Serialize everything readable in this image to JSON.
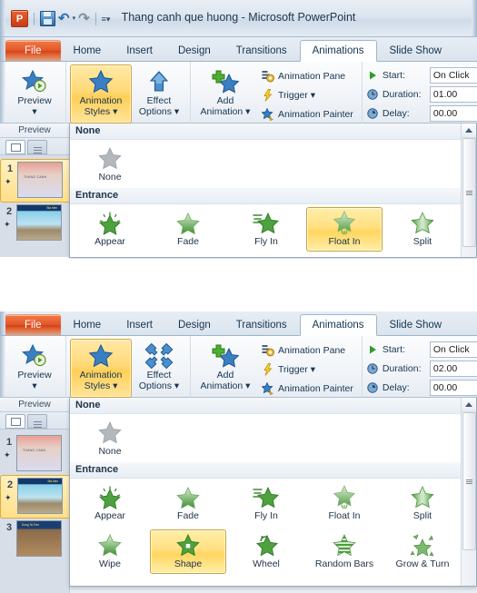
{
  "app": {
    "title": "Thang canh que huong  -  Microsoft PowerPoint",
    "logo_text": "P",
    "quick_access": [
      {
        "name": "save-icon",
        "label": "Save"
      },
      {
        "name": "undo-icon",
        "label": "↶"
      },
      {
        "name": "undo-dropdown-icon",
        "label": "▾"
      },
      {
        "name": "redo-icon",
        "label": "↷"
      },
      {
        "name": "customize-qat-icon",
        "label": "≡▾"
      }
    ]
  },
  "tabs": [
    {
      "label": "File",
      "state": "file"
    },
    {
      "label": "Home",
      "state": "normal"
    },
    {
      "label": "Insert",
      "state": "normal"
    },
    {
      "label": "Design",
      "state": "normal"
    },
    {
      "label": "Transitions",
      "state": "normal"
    },
    {
      "label": "Animations",
      "state": "active"
    },
    {
      "label": "Slide Show",
      "state": "normal"
    }
  ],
  "ribbon": {
    "preview": {
      "label_line1": "Preview",
      "dropdown": "▾",
      "group_label": "Preview"
    },
    "animation_styles": {
      "label_line1": "Animation",
      "label_line2": "Styles ▾"
    },
    "effect_options": {
      "label_line1": "Effect",
      "label_line2": "Options ▾"
    },
    "add_animation": {
      "label_line1": "Add",
      "label_line2": "Animation ▾"
    },
    "advanced": [
      {
        "label": "Animation Pane",
        "icon": "animation-pane-icon"
      },
      {
        "label": "Trigger ▾",
        "icon": "trigger-lightning-icon"
      },
      {
        "label": "Animation Painter",
        "icon": "animation-painter-icon"
      }
    ],
    "timing_panel1": {
      "start": {
        "label": "Start:",
        "value": "On Click",
        "icon": "play-triangle-icon"
      },
      "duration": {
        "label": "Duration:",
        "value": "01.00",
        "icon": "clock-icon"
      },
      "delay": {
        "label": "Delay:",
        "value": "00.00",
        "icon": "clock-icon"
      }
    },
    "timing_panel2": {
      "start": {
        "label": "Start:",
        "value": "On Click",
        "icon": "play-triangle-icon"
      },
      "duration": {
        "label": "Duration:",
        "value": "02.00",
        "icon": "clock-icon"
      },
      "delay": {
        "label": "Delay:",
        "value": "00.00",
        "icon": "clock-icon"
      }
    }
  },
  "slide_pane": {
    "preview_label": "Preview",
    "panel1": {
      "slides": [
        {
          "number": "1",
          "selected": true,
          "theme": "sl1",
          "caption": "THANG CANH"
        },
        {
          "number": "2",
          "selected": false,
          "theme": "sl2",
          "caption": "Bia bien"
        }
      ]
    },
    "panel2": {
      "slides": [
        {
          "number": "1",
          "selected": false,
          "theme": "sl1",
          "caption": "THANG CANH"
        },
        {
          "number": "2",
          "selected": true,
          "theme": "sl2",
          "caption": "Bia bien"
        },
        {
          "number": "3",
          "selected": false,
          "theme": "sl3",
          "caption": "Dong Ta Tren"
        }
      ]
    }
  },
  "gallery": {
    "headings": {
      "none": "None",
      "entrance": "Entrance"
    },
    "none_item": {
      "label": "None"
    },
    "panel1": {
      "entrance_rows": [
        [
          {
            "label": "Appear",
            "selected": false,
            "star": "sparkle"
          },
          {
            "label": "Fade",
            "selected": false,
            "star": "plain"
          },
          {
            "label": "Fly In",
            "selected": false,
            "star": "speed"
          },
          {
            "label": "Float In",
            "selected": true,
            "star": "float"
          },
          {
            "label": "Split",
            "selected": false,
            "star": "split"
          }
        ]
      ]
    },
    "panel2": {
      "entrance_rows": [
        [
          {
            "label": "Appear",
            "selected": false,
            "star": "sparkle"
          },
          {
            "label": "Fade",
            "selected": false,
            "star": "plain"
          },
          {
            "label": "Fly In",
            "selected": false,
            "star": "speed"
          },
          {
            "label": "Float In",
            "selected": false,
            "star": "float"
          },
          {
            "label": "Split",
            "selected": false,
            "star": "split"
          }
        ],
        [
          {
            "label": "Wipe",
            "selected": false,
            "star": "wipe"
          },
          {
            "label": "Shape",
            "selected": true,
            "star": "shape"
          },
          {
            "label": "Wheel",
            "selected": false,
            "star": "wheel"
          },
          {
            "label": "Random Bars",
            "selected": false,
            "star": "bars"
          },
          {
            "label": "Grow & Turn",
            "selected": false,
            "star": "grow"
          }
        ]
      ]
    }
  },
  "colors": {
    "file_tab": "#d6410f",
    "selected_gold": "#ffd65e",
    "ribbon_bg": "#f1f4f8",
    "entrance_green": "#4b9b3f",
    "accent_blue": "#2f6ea8"
  }
}
